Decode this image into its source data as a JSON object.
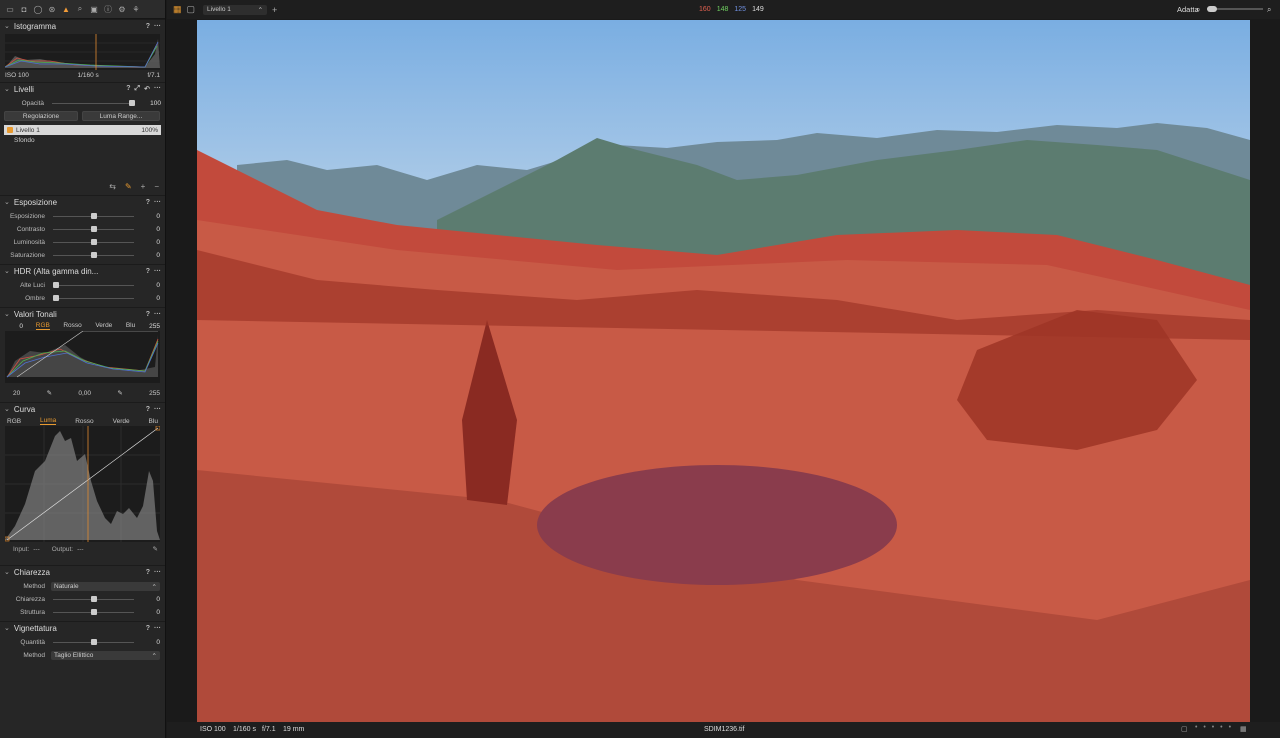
{
  "toolbar": {
    "tabs": [
      "library-icon",
      "camera-icon",
      "lens-icon",
      "color-icon",
      "exposure-icon",
      "details-icon",
      "adjustments-icon",
      "metadata-icon",
      "output-icon",
      "batch-icon"
    ]
  },
  "histogram": {
    "title": "Istogramma",
    "iso": "ISO 100",
    "shutter": "1/160 s",
    "aperture": "f/7.1"
  },
  "layers": {
    "title": "Livelli",
    "opacity_label": "Opacità",
    "opacity_value": "100",
    "opacity": 1.0,
    "adjust_label": "Regolazione",
    "luma_label": "Luma Range...",
    "items": [
      {
        "name": "Livello 1",
        "pct": "100%",
        "checked": true
      },
      {
        "name": "Sfondo"
      }
    ]
  },
  "exposure": {
    "title": "Esposizione",
    "rows": [
      {
        "label": "Esposizione",
        "value": "0"
      },
      {
        "label": "Contrasto",
        "value": "0"
      },
      {
        "label": "Luminosità",
        "value": "0"
      },
      {
        "label": "Saturazione",
        "value": "0"
      }
    ]
  },
  "hdr": {
    "title": "HDR (Alta gamma din...",
    "rows": [
      {
        "label": "Alte Luci",
        "value": "0"
      },
      {
        "label": "Ombre",
        "value": "0"
      }
    ]
  },
  "levels": {
    "title": "Valori Tonali",
    "left": "0",
    "right": "255",
    "tabs": [
      "RGB",
      "Rosso",
      "Verde",
      "Blu"
    ],
    "active": "RGB",
    "low": "20",
    "mid": "0,00",
    "high": "255"
  },
  "curve": {
    "title": "Curva",
    "tabs": [
      "RGB",
      "Luma",
      "Rosso",
      "Verde",
      "Blu"
    ],
    "active": "Luma",
    "input_label": "Input:",
    "input_val": "---",
    "output_label": "Output:",
    "output_val": "---"
  },
  "clarity": {
    "title": "Chiarezza",
    "method_label": "Method",
    "method_value": "Naturale",
    "rows": [
      {
        "label": "Chiarezza",
        "value": "0"
      },
      {
        "label": "Struttura",
        "value": "0"
      }
    ]
  },
  "vignette": {
    "title": "Vignettatura",
    "rows": [
      {
        "label": "Quantità",
        "value": "0"
      }
    ],
    "method_label": "Method",
    "method_value": "Taglio Ellittico"
  },
  "topbar": {
    "layer_select": "Livello 1",
    "rgb": {
      "r": "160",
      "g": "148",
      "b": "125",
      "l": "149"
    },
    "fit": "Adatta",
    "colors": {
      "r": "#e06050",
      "g": "#60d060",
      "b": "#6a8ae0"
    }
  },
  "statusbar": {
    "iso": "ISO 100",
    "shutter": "1/160 s",
    "aperture": "f/7.1",
    "focal": "19 mm",
    "file": "SDIM1236.tif"
  }
}
